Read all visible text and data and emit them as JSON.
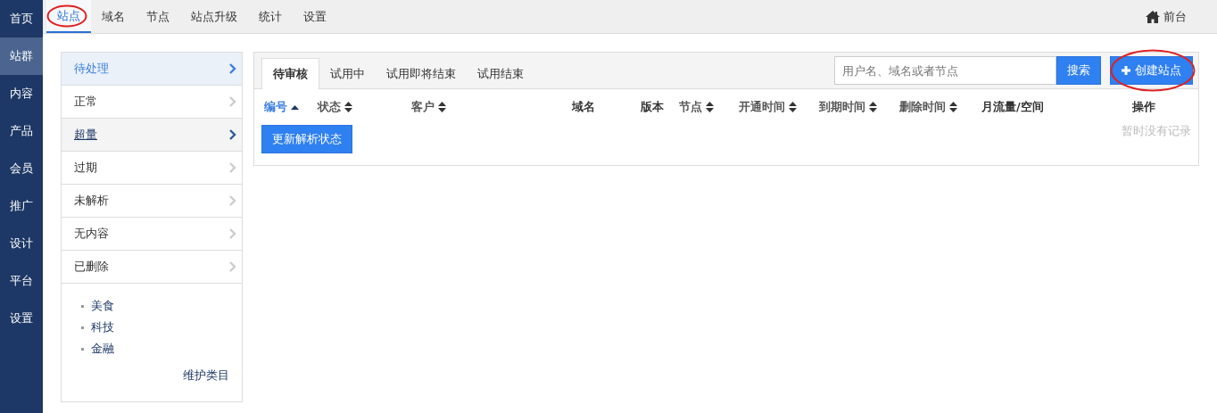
{
  "nav": [
    {
      "label": "首页",
      "selected": false
    },
    {
      "label": "站群",
      "selected": true
    },
    {
      "label": "内容",
      "selected": false
    },
    {
      "label": "产品",
      "selected": false
    },
    {
      "label": "会员",
      "selected": false
    },
    {
      "label": "推广",
      "selected": false
    },
    {
      "label": "设计",
      "selected": false
    },
    {
      "label": "平台",
      "selected": false
    },
    {
      "label": "设置",
      "selected": false
    }
  ],
  "top_tabs": [
    {
      "label": "站点",
      "selected": true,
      "circled": true
    },
    {
      "label": "域名",
      "selected": false,
      "circled": false
    },
    {
      "label": "节点",
      "selected": false,
      "circled": false
    },
    {
      "label": "站点升级",
      "selected": false,
      "circled": false
    },
    {
      "label": "统计",
      "selected": false,
      "circled": false
    },
    {
      "label": "设置",
      "selected": false,
      "circled": false
    }
  ],
  "frontend_link": "前台",
  "status_list": [
    {
      "label": "待处理",
      "selected": true,
      "hovered": false
    },
    {
      "label": "正常",
      "selected": false,
      "hovered": false
    },
    {
      "label": "超量",
      "selected": false,
      "hovered": true
    },
    {
      "label": "过期",
      "selected": false,
      "hovered": false
    },
    {
      "label": "未解析",
      "selected": false,
      "hovered": false
    },
    {
      "label": "无内容",
      "selected": false,
      "hovered": false
    },
    {
      "label": "已删除",
      "selected": false,
      "hovered": false
    }
  ],
  "categories": [
    "美食",
    "科技",
    "金融"
  ],
  "maintain_link": "维护类目",
  "tabs": [
    {
      "label": "待审核",
      "selected": true
    },
    {
      "label": "试用中",
      "selected": false
    },
    {
      "label": "试用即将结束",
      "selected": false
    },
    {
      "label": "试用结束",
      "selected": false
    }
  ],
  "search": {
    "placeholder": "用户名、域名或者节点",
    "button": "搜索"
  },
  "create_button": {
    "label": "创建站点",
    "circled": true
  },
  "table": {
    "columns": [
      {
        "label": "编号",
        "sortable": true,
        "sorted": true
      },
      {
        "label": "状态",
        "sortable": true,
        "sorted": false
      },
      {
        "label": "客户",
        "sortable": true,
        "sorted": false
      },
      {
        "label": "域名",
        "sortable": false,
        "sorted": false
      },
      {
        "label": "版本",
        "sortable": false,
        "sorted": false
      },
      {
        "label": "节点",
        "sortable": true,
        "sorted": false
      },
      {
        "label": "开通时间",
        "sortable": true,
        "sorted": false
      },
      {
        "label": "到期时间",
        "sortable": true,
        "sorted": false
      },
      {
        "label": "删除时间",
        "sortable": true,
        "sorted": false
      },
      {
        "label": "月流量/空间",
        "sortable": false,
        "sorted": false
      },
      {
        "label": "操作",
        "sortable": false,
        "sorted": false
      }
    ],
    "update_button": "更新解析状态",
    "empty_text": "暂时没有记录"
  }
}
